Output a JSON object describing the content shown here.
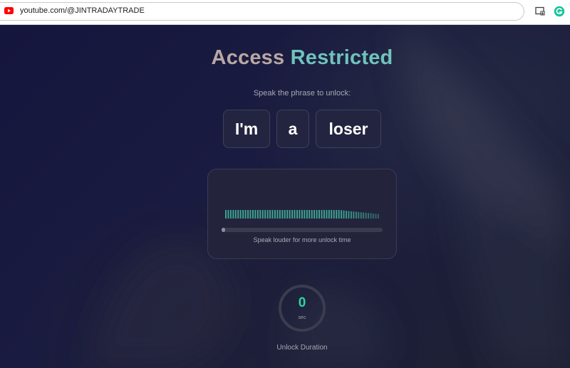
{
  "browser": {
    "url": "youtube.com/@JINTRADAYTRADE",
    "site_icon": "youtube-icon",
    "extensions": [
      "media-download-icon",
      "grammarly-icon"
    ]
  },
  "page": {
    "title_part1": "Access",
    "title_part2": "Restricted",
    "prompt": "Speak the phrase to unlock:",
    "phrase_words": [
      "I'm",
      "a",
      "loser"
    ],
    "hint": "Speak louder for more unlock time",
    "progress_fraction": 0.02,
    "timer_value": "0",
    "timer_unit": "sec",
    "timer_label": "Unlock Duration"
  },
  "colors": {
    "title_part1": "#b8a8a4",
    "title_part2": "#6fc3bb",
    "meter_bar": "#3fae99",
    "timer_value": "#2fd5a2"
  }
}
